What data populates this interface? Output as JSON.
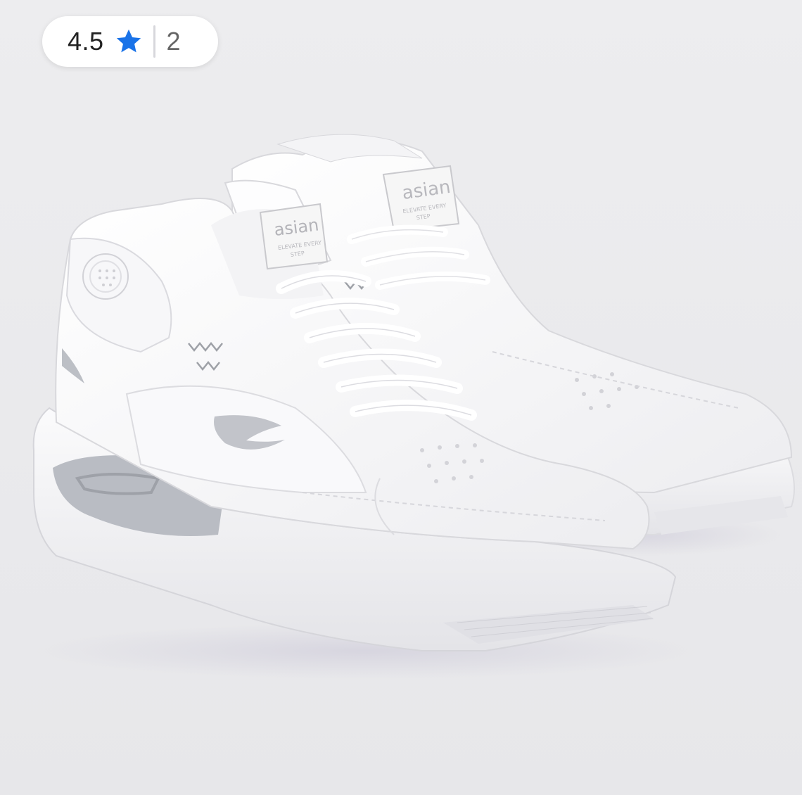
{
  "rating": {
    "value": "4.5",
    "count": "2",
    "star_icon": "star-icon",
    "star_color": "#1a73e8"
  },
  "product_image": {
    "brand_logo": "asian",
    "tag_line_1": "ELEVATE EVERY",
    "tag_line_2": "STEP"
  }
}
